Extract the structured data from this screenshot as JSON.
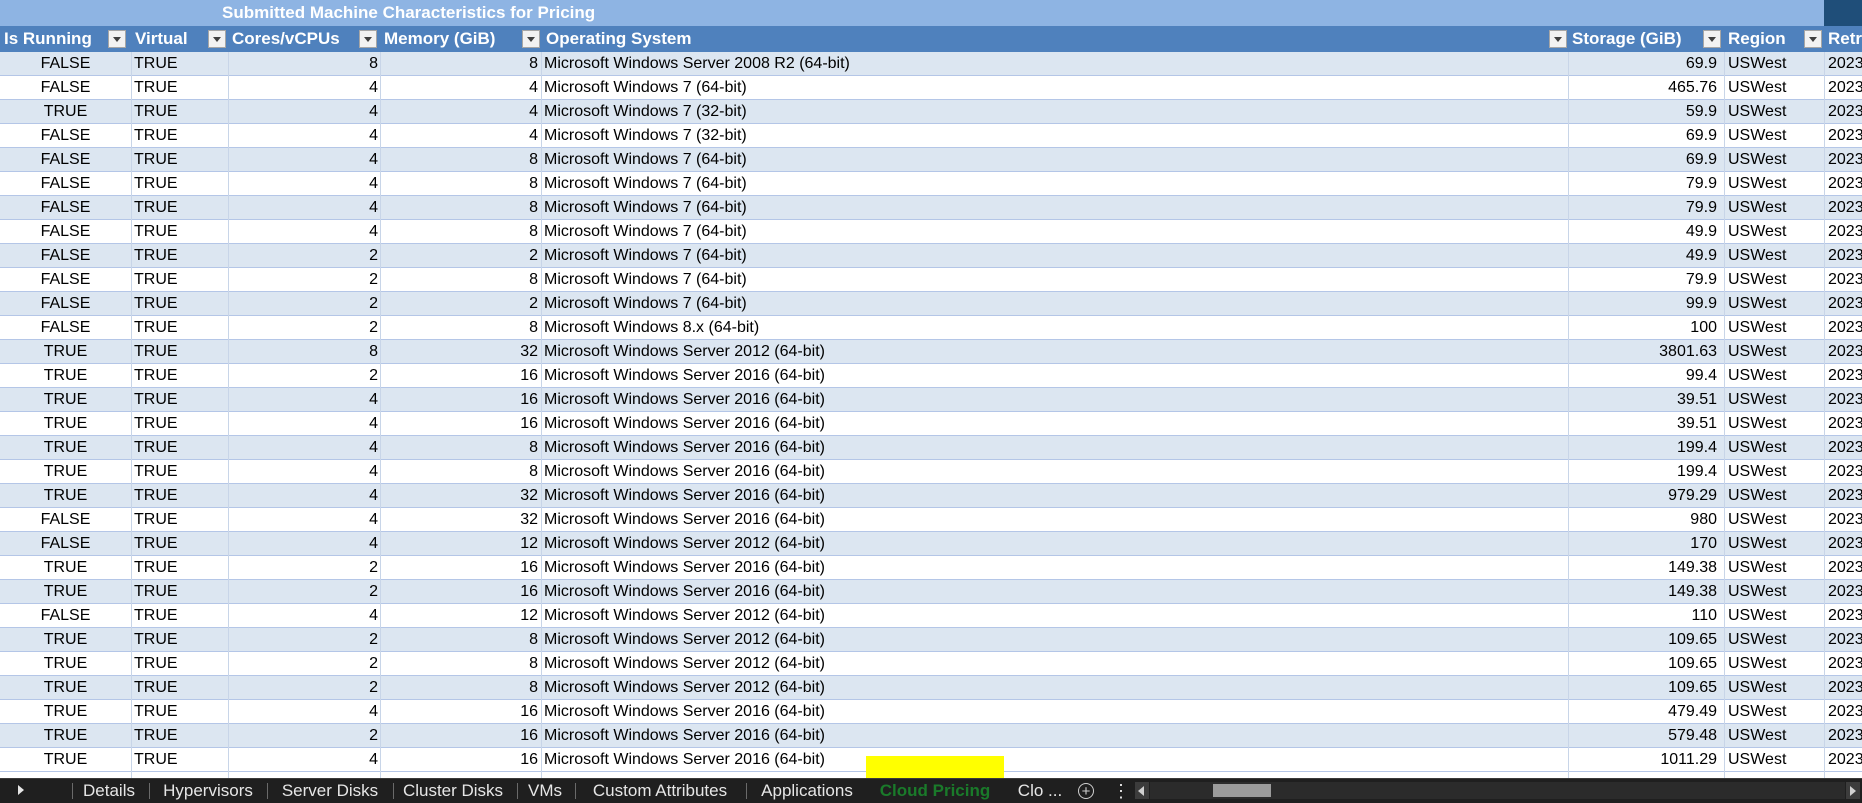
{
  "sheet": {
    "title": "Submitted Machine Characteristics for Pricing",
    "headers": {
      "is_running": "Is Running",
      "virtual": "Virtual",
      "cores": "Cores/vCPUs",
      "memory": "Memory (GiB)",
      "os": "Operating System",
      "storage": "Storage (GiB)",
      "region": "Region",
      "retrieved": "Retr"
    },
    "rows": [
      [
        "FALSE",
        "TRUE",
        "8",
        "8",
        "Microsoft Windows Server 2008 R2 (64-bit)",
        "69.9",
        "USWest",
        "2023"
      ],
      [
        "FALSE",
        "TRUE",
        "4",
        "4",
        "Microsoft Windows 7 (64-bit)",
        "465.76",
        "USWest",
        "2023"
      ],
      [
        "TRUE",
        "TRUE",
        "4",
        "4",
        "Microsoft Windows 7 (32-bit)",
        "59.9",
        "USWest",
        "2023"
      ],
      [
        "FALSE",
        "TRUE",
        "4",
        "4",
        "Microsoft Windows 7 (32-bit)",
        "69.9",
        "USWest",
        "2023"
      ],
      [
        "FALSE",
        "TRUE",
        "4",
        "8",
        "Microsoft Windows 7 (64-bit)",
        "69.9",
        "USWest",
        "2023"
      ],
      [
        "FALSE",
        "TRUE",
        "4",
        "8",
        "Microsoft Windows 7 (64-bit)",
        "79.9",
        "USWest",
        "2023"
      ],
      [
        "FALSE",
        "TRUE",
        "4",
        "8",
        "Microsoft Windows 7 (64-bit)",
        "79.9",
        "USWest",
        "2023"
      ],
      [
        "FALSE",
        "TRUE",
        "4",
        "8",
        "Microsoft Windows 7 (64-bit)",
        "49.9",
        "USWest",
        "2023"
      ],
      [
        "FALSE",
        "TRUE",
        "2",
        "2",
        "Microsoft Windows 7 (64-bit)",
        "49.9",
        "USWest",
        "2023"
      ],
      [
        "FALSE",
        "TRUE",
        "2",
        "8",
        "Microsoft Windows 7 (64-bit)",
        "79.9",
        "USWest",
        "2023"
      ],
      [
        "FALSE",
        "TRUE",
        "2",
        "2",
        "Microsoft Windows 7 (64-bit)",
        "99.9",
        "USWest",
        "2023"
      ],
      [
        "FALSE",
        "TRUE",
        "2",
        "8",
        "Microsoft Windows 8.x (64-bit)",
        "100",
        "USWest",
        "2023"
      ],
      [
        "TRUE",
        "TRUE",
        "8",
        "32",
        "Microsoft Windows Server 2012 (64-bit)",
        "3801.63",
        "USWest",
        "2023"
      ],
      [
        "TRUE",
        "TRUE",
        "2",
        "16",
        "Microsoft Windows Server 2016 (64-bit)",
        "99.4",
        "USWest",
        "2023"
      ],
      [
        "TRUE",
        "TRUE",
        "4",
        "16",
        "Microsoft Windows Server 2016 (64-bit)",
        "39.51",
        "USWest",
        "2023"
      ],
      [
        "TRUE",
        "TRUE",
        "4",
        "16",
        "Microsoft Windows Server 2016 (64-bit)",
        "39.51",
        "USWest",
        "2023"
      ],
      [
        "TRUE",
        "TRUE",
        "4",
        "8",
        "Microsoft Windows Server 2016 (64-bit)",
        "199.4",
        "USWest",
        "2023"
      ],
      [
        "TRUE",
        "TRUE",
        "4",
        "8",
        "Microsoft Windows Server 2016 (64-bit)",
        "199.4",
        "USWest",
        "2023"
      ],
      [
        "TRUE",
        "TRUE",
        "4",
        "32",
        "Microsoft Windows Server 2016 (64-bit)",
        "979.29",
        "USWest",
        "2023"
      ],
      [
        "FALSE",
        "TRUE",
        "4",
        "32",
        "Microsoft Windows Server 2016 (64-bit)",
        "980",
        "USWest",
        "2023"
      ],
      [
        "FALSE",
        "TRUE",
        "4",
        "12",
        "Microsoft Windows Server 2012 (64-bit)",
        "170",
        "USWest",
        "2023"
      ],
      [
        "TRUE",
        "TRUE",
        "2",
        "16",
        "Microsoft Windows Server 2016 (64-bit)",
        "149.38",
        "USWest",
        "2023"
      ],
      [
        "TRUE",
        "TRUE",
        "2",
        "16",
        "Microsoft Windows Server 2016 (64-bit)",
        "149.38",
        "USWest",
        "2023"
      ],
      [
        "FALSE",
        "TRUE",
        "4",
        "12",
        "Microsoft Windows Server 2012 (64-bit)",
        "110",
        "USWest",
        "2023"
      ],
      [
        "TRUE",
        "TRUE",
        "2",
        "8",
        "Microsoft Windows Server 2012 (64-bit)",
        "109.65",
        "USWest",
        "2023"
      ],
      [
        "TRUE",
        "TRUE",
        "2",
        "8",
        "Microsoft Windows Server 2012 (64-bit)",
        "109.65",
        "USWest",
        "2023"
      ],
      [
        "TRUE",
        "TRUE",
        "2",
        "8",
        "Microsoft Windows Server 2012 (64-bit)",
        "109.65",
        "USWest",
        "2023"
      ],
      [
        "TRUE",
        "TRUE",
        "4",
        "16",
        "Microsoft Windows Server 2016 (64-bit)",
        "479.49",
        "USWest",
        "2023"
      ],
      [
        "TRUE",
        "TRUE",
        "2",
        "16",
        "Microsoft Windows Server 2016 (64-bit)",
        "579.48",
        "USWest",
        "2023"
      ],
      [
        "TRUE",
        "TRUE",
        "4",
        "16",
        "Microsoft Windows Server 2016 (64-bit)",
        "1011.29",
        "USWest",
        "2023"
      ]
    ]
  },
  "tabs": {
    "items": [
      "Details",
      "Hypervisors",
      "Server Disks",
      "Cluster Disks",
      "VMs",
      "Custom Attributes",
      "Applications",
      "Cloud Pricing",
      "Clo ..."
    ],
    "active": "Cloud Pricing"
  },
  "colors": {
    "header_bg": "#4f81bd",
    "title_bg": "#8eb4e3",
    "band_bg": "#dce6f1",
    "active_tab_highlight": "#ffff00",
    "active_tab_text": "#1a7a2a"
  },
  "icons": {
    "filter": "filter-dropdown-icon",
    "add_sheet": "plus-circle-icon",
    "more": "kebab-menu-icon",
    "nav": "chevron-right-icon"
  }
}
